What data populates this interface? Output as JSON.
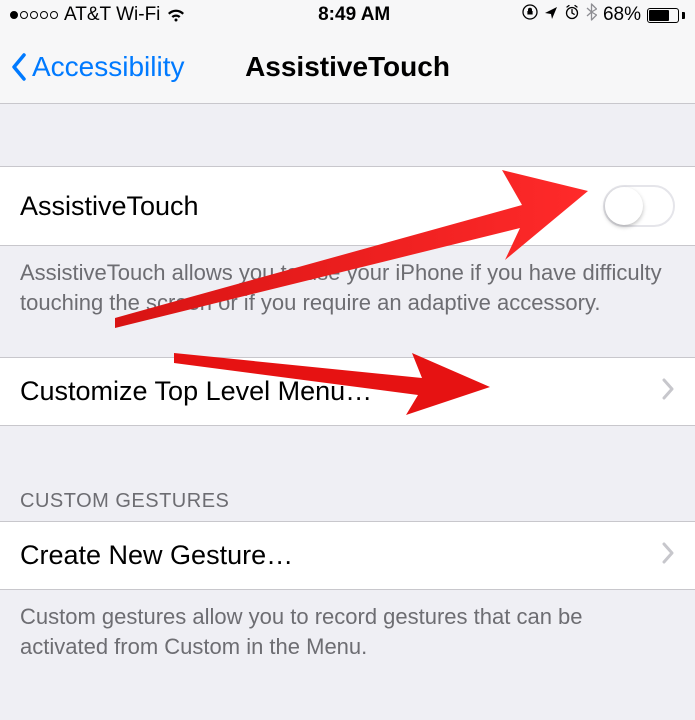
{
  "status": {
    "carrier": "AT&T Wi-Fi",
    "time": "8:49 AM",
    "battery_pct": "68%"
  },
  "nav": {
    "back_label": "Accessibility",
    "title": "AssistiveTouch"
  },
  "cells": {
    "assistive_touch": "AssistiveTouch",
    "customize": "Customize Top Level Menu…",
    "create_gesture": "Create New Gesture…"
  },
  "footers": {
    "assistive_desc": "AssistiveTouch allows you to use your iPhone if you have difficulty touching the screen or if you require an adaptive accessory.",
    "custom_desc": "Custom gestures allow you to record gestures that can be activated from Custom in the Menu."
  },
  "headers": {
    "custom_gestures": "CUSTOM GESTURES"
  }
}
